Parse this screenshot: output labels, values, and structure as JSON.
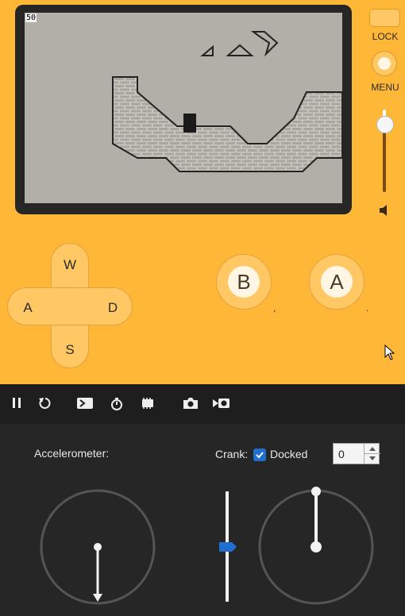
{
  "screen": {
    "fps": "50"
  },
  "side_buttons": {
    "lock_label": "LOCK",
    "menu_label": "MENU"
  },
  "dpad": {
    "up": "W",
    "left": "A",
    "right": "D",
    "down": "S"
  },
  "buttons": {
    "b_label": "B",
    "a_label": "A",
    "b_key": ",",
    "a_key": "."
  },
  "toolbar": {
    "icons": [
      "pause-icon",
      "restart-icon",
      "console-icon",
      "stopwatch-icon",
      "device-icon",
      "camera-icon",
      "video-icon"
    ]
  },
  "controls": {
    "accelerometer_label": "Accelerometer:",
    "crank_label": "Crank:",
    "docked_label": "Docked",
    "docked_checked": true,
    "crank_angle_value": "0"
  },
  "colors": {
    "device": "#ffb738",
    "panel": "#262626",
    "accent": "#1f6fd1"
  }
}
